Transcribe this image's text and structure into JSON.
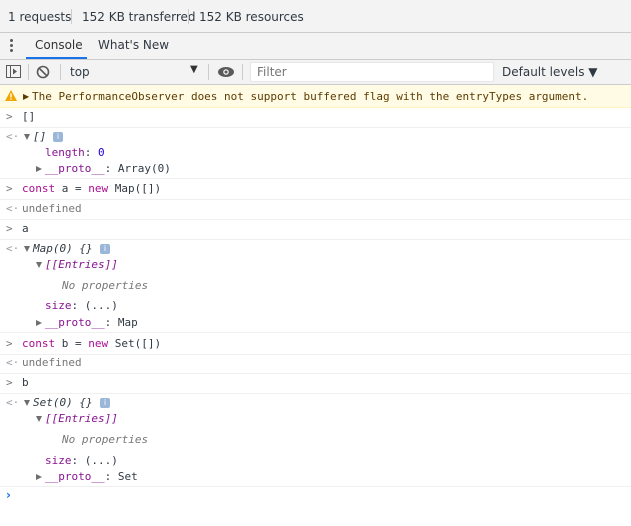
{
  "summary": {
    "requests": "1 requests",
    "transferred": "152 KB transferred",
    "resources": "152 KB resources"
  },
  "tabs": [
    {
      "label": "Console",
      "active": true
    },
    {
      "label": "What's New",
      "active": false
    }
  ],
  "toolbar": {
    "context": "top",
    "filter_placeholder": "Filter",
    "levels": "Default levels ▼"
  },
  "warning": {
    "message": "The PerformanceObserver does not support buffered flag with the entryTypes argument."
  },
  "console": {
    "l1_input": "[]",
    "l2_result": "[]",
    "l2_info": "i",
    "l3_key": "length",
    "l3_val": "0",
    "l4_key": "__proto__",
    "l4_val": "Array(0)",
    "l5_kw1": "const",
    "l5_mid1": "a =",
    "l5_kw2": "new",
    "l5_rest": "Map([])",
    "l6": "undefined",
    "l7": "a",
    "l8_result": "Map(0) {}",
    "l8_info": "i",
    "l9": "[[Entries]]",
    "l10": "No properties",
    "l11_key": "size",
    "l11_val": "(...)",
    "l12_key": "__proto__",
    "l12_val": "Map",
    "l13_kw1": "const",
    "l13_mid1": "b =",
    "l13_kw2": "new",
    "l13_rest": "Set([])",
    "l14": "undefined",
    "l15": "b",
    "l16_result": "Set(0) {}",
    "l16_info": "i",
    "l17": "[[Entries]]",
    "l18": "No properties",
    "l19_key": "size",
    "l19_val": "(...)",
    "l20_key": "__proto__",
    "l20_val": "Set"
  }
}
